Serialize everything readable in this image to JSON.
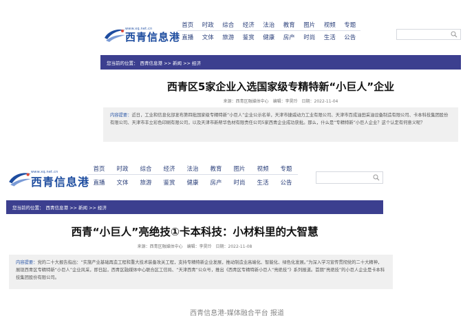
{
  "site": {
    "logo_url": "www.xq.net.cn",
    "logo_name": "西青信息港"
  },
  "nav": {
    "row1": [
      "首页",
      "时政",
      "综合",
      "经济",
      "法治",
      "教育",
      "图片",
      "视频",
      "专题"
    ],
    "row2": [
      "直播",
      "文体",
      "旅游",
      "鉴赏",
      "健康",
      "房产",
      "时尚",
      "生活",
      "公告"
    ]
  },
  "breadcrumb": {
    "label": "您当前的位置：",
    "path": "西青信息港 >> 新闻 >> 经济"
  },
  "articles": [
    {
      "title": "西青区5家企业入选国家级专精特新“小巨人”企业",
      "source": "来源：西青区融媒体中心",
      "editor": "编辑：李昊玲",
      "date": "日期：2022-11-04",
      "summary_label": "内容提要：",
      "summary_text": "近日，工业和信息化部发布第四批国家级专精特新“小巨人”企业公示名单，天津市捷威动力工业有限公司、天津市百成油田采油设备制造有限公司、卡本科技集团股份有限公司、天津市丰立彩色印刷有限公司，以及天津市新帮华色材有限责任公司5家西青企业成功获批。那么，什么是“专精特新”小巨人企业？这个认定有何意义呢？"
    },
    {
      "title": "西青“小巨人”亮绝技①卡本科技：小材料里的大智慧",
      "source": "来源：西青区融媒体中心",
      "editor": "编辑：李昊玲",
      "date": "日期：2022-11-08",
      "summary_label": "内容提要：",
      "summary_text": "党的二十大报告指出：“实施产业基础再造工程和重大技术装备攻关工程，支持专精特新企业发展，推动制造业高端化、智能化、绿色化发展。”为深入学习宣传贯彻党的二十大精神，展现西青区专精特新“小巨人”企业风采，即日起，西青区融媒体中心联合区工信局、“天津西青”公众号，推出《西青区专精特新小巨人“亮绝技”》系列报道。首期“亮绝技”的小巨人企业是卡本科技集团股份有限公司。"
    }
  ],
  "caption": "西青信息港-媒体融合平台 报道",
  "colors": {
    "breadcrumb_bg": "#3c3f8f",
    "logo_blue": "#1d4c9f",
    "summary_label": "#2c58a8"
  }
}
